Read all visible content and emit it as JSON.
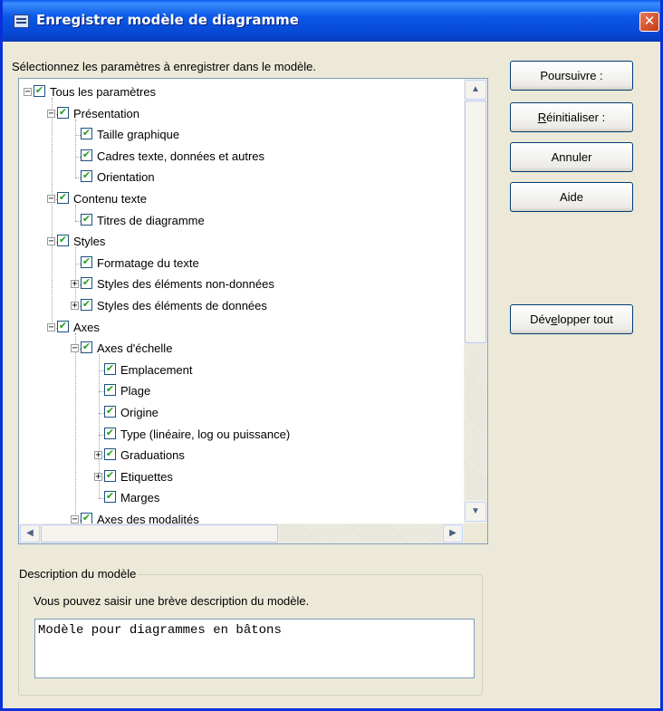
{
  "window": {
    "title": "Enregistrer modèle de diagramme",
    "close_label": "✕"
  },
  "prompt": "Sélectionnez les paramètres à enregistrer dans le modèle.",
  "tree": {
    "nodes": [
      {
        "label": "Tous les paramètres",
        "checked": true,
        "expander": "minus"
      },
      {
        "label": "Présentation",
        "checked": true,
        "expander": "minus"
      },
      {
        "label": "Taille graphique",
        "checked": true
      },
      {
        "label": "Cadres texte, données et autres",
        "checked": true
      },
      {
        "label": "Orientation",
        "checked": true
      },
      {
        "label": "Contenu texte",
        "checked": true,
        "expander": "minus"
      },
      {
        "label": "Titres de diagramme",
        "checked": true
      },
      {
        "label": "Styles",
        "checked": true,
        "expander": "minus"
      },
      {
        "label": "Formatage du texte",
        "checked": true
      },
      {
        "label": "Styles des éléments non-données",
        "checked": true,
        "expander": "plus"
      },
      {
        "label": "Styles des éléments de données",
        "checked": true,
        "expander": "plus"
      },
      {
        "label": "Axes",
        "checked": true,
        "expander": "minus"
      },
      {
        "label": "Axes d'échelle",
        "checked": true,
        "expander": "minus"
      },
      {
        "label": "Emplacement",
        "checked": true
      },
      {
        "label": "Plage",
        "checked": true
      },
      {
        "label": "Origine",
        "checked": true
      },
      {
        "label": "Type (linéaire, log ou puissance)",
        "checked": true
      },
      {
        "label": "Graduations",
        "checked": true,
        "expander": "plus"
      },
      {
        "label": "Etiquettes",
        "checked": true,
        "expander": "plus"
      },
      {
        "label": "Marges",
        "checked": true
      },
      {
        "label": "Axes des modalités",
        "checked": true,
        "expander": "minus"
      }
    ]
  },
  "buttons": {
    "continue": "Poursuivre :",
    "reset_mnemonic": "R",
    "reset_rest": "éinitialiser :",
    "cancel": "Annuler",
    "help": "Aide",
    "expand_pre": "Dév",
    "expand_mnemonic": "e",
    "expand_post": "lopper tout"
  },
  "description": {
    "legend": "Description du modèle",
    "hint": "Vous pouvez saisir une brève description du modèle.",
    "value": "Modèle pour diagrammes en bâtons"
  },
  "scroll": {
    "up_arrow": "▲",
    "down_arrow": "▼",
    "left_arrow": "◀",
    "right_arrow": "▶",
    "vertical_position": 0.0,
    "horizontal_position": 0.0
  },
  "check_glyph": "✔",
  "colors": {
    "title_bar": "#0a58e8",
    "close_button": "#c43a12",
    "dialog_background": "#ece9d8",
    "checkbox_mark": "#21a121"
  }
}
